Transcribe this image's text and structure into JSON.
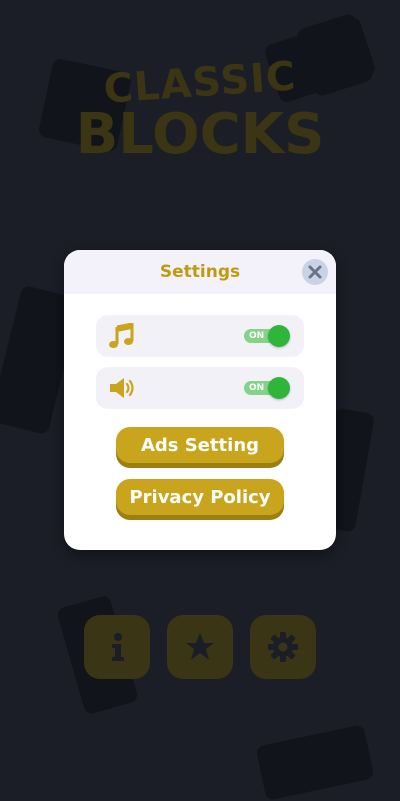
{
  "background": {
    "logo": {
      "line1": "CLASSIC",
      "line2": "BLOCKS"
    },
    "bottom_buttons": [
      {
        "name": "info",
        "icon": "info-icon"
      },
      {
        "name": "leaderboard",
        "icon": "star-icon"
      },
      {
        "name": "settings",
        "icon": "gear-icon"
      }
    ]
  },
  "settings_dialog": {
    "title": "Settings",
    "close_icon": "close-icon",
    "rows": [
      {
        "icon": "music-note-icon",
        "toggle_label": "ON",
        "state": "on"
      },
      {
        "icon": "speaker-icon",
        "toggle_label": "ON",
        "state": "on"
      }
    ],
    "ads_button_label": "Ads Setting",
    "privacy_button_label": "Privacy Policy"
  },
  "colors": {
    "accent_gold": "#c9a51d",
    "title_gold": "#c29a10",
    "toggle_on": "#2fb53a",
    "backdrop": "#1b1e27"
  }
}
